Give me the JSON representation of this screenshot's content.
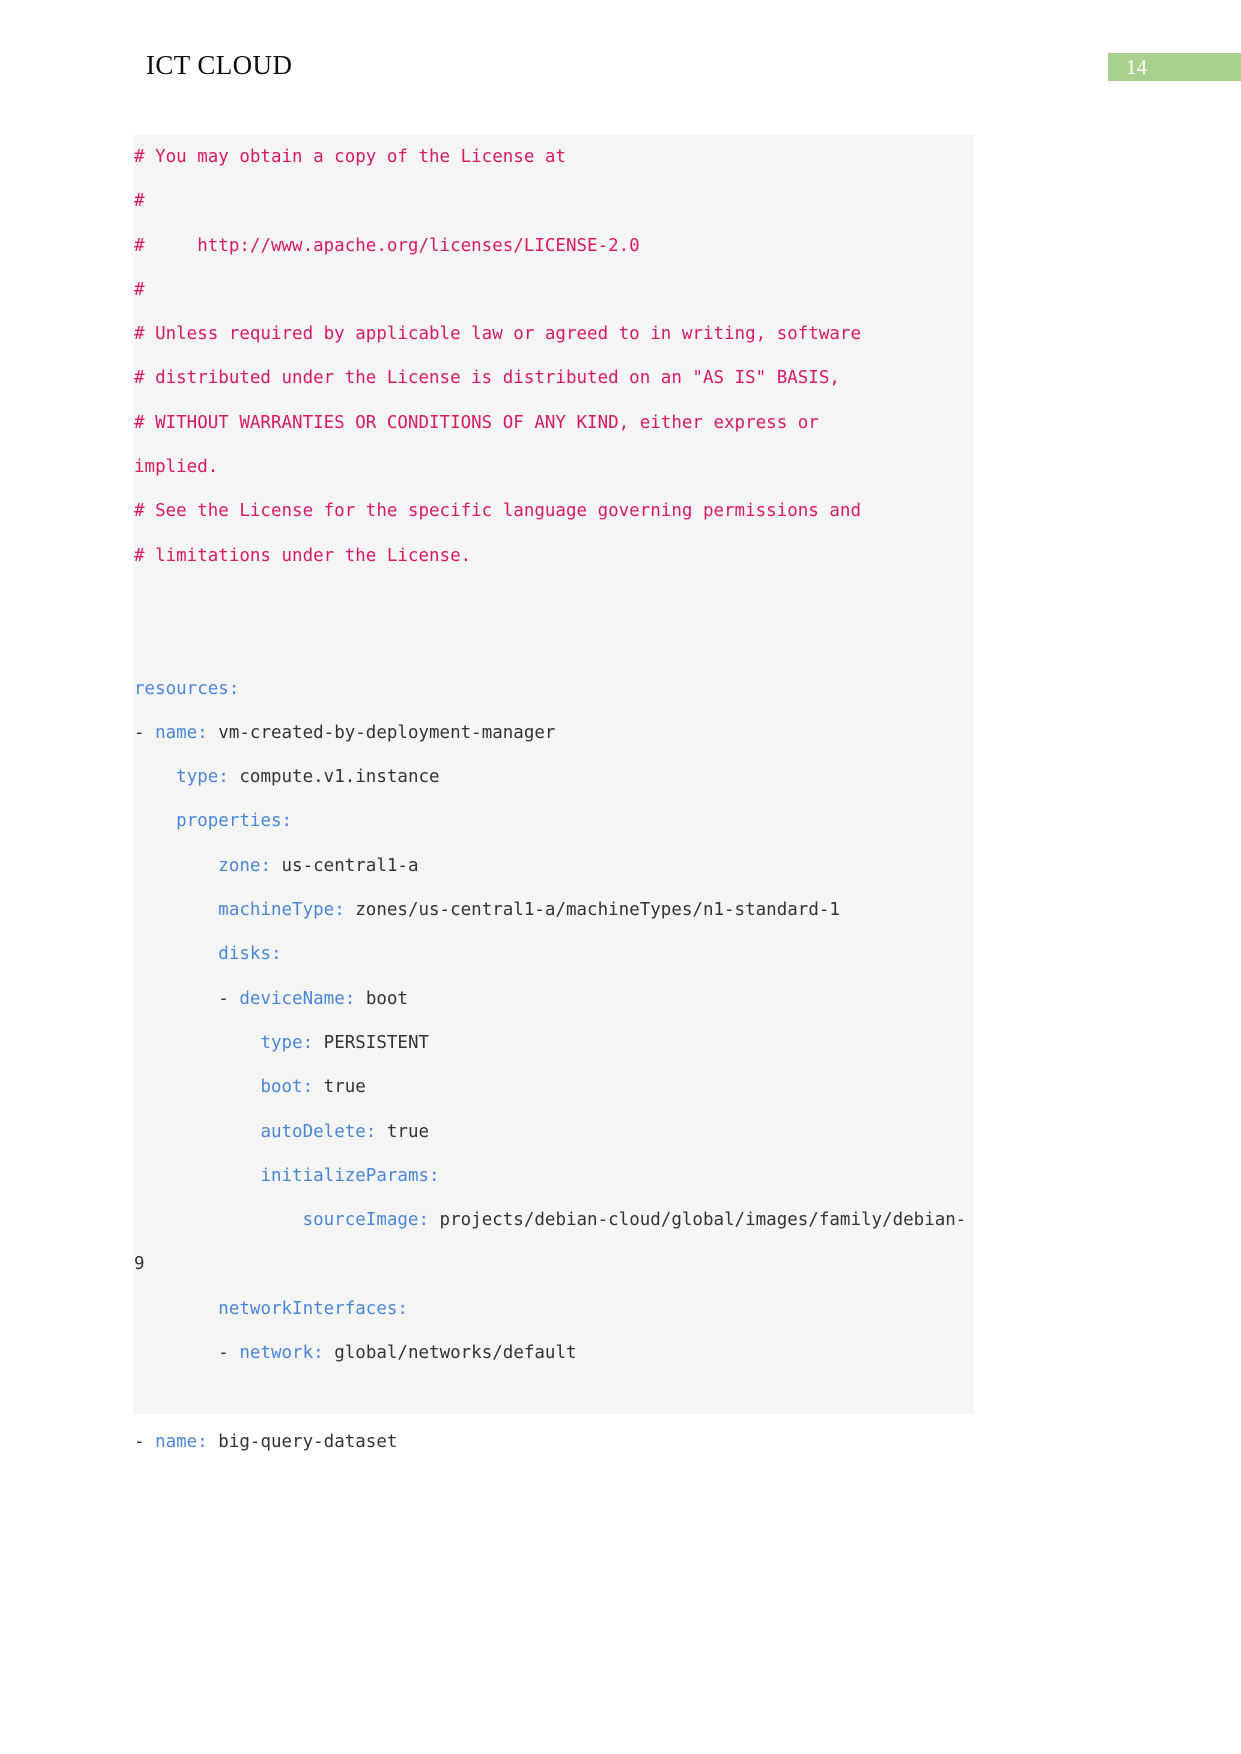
{
  "header": {
    "title": "ICT CLOUD",
    "page_number": "14",
    "badge_color": "#a9d18e",
    "badge_text_color": "#ffffff"
  },
  "code_block": {
    "background_color": "#f5f5f5",
    "comment_color": "#d81b60",
    "key_color": "#4a86d8",
    "value_color": "#333333",
    "language": "yaml",
    "lines": [
      {
        "indent": 0,
        "type": "comment",
        "text": "# You may obtain a copy of the License at"
      },
      {
        "indent": 0,
        "type": "comment",
        "text": "#"
      },
      {
        "indent": 0,
        "type": "comment",
        "text": "#     http://www.apache.org/licenses/LICENSE-2.0"
      },
      {
        "indent": 0,
        "type": "comment",
        "text": "#"
      },
      {
        "indent": 0,
        "type": "comment",
        "text": "# Unless required by applicable law or agreed to in writing, software"
      },
      {
        "indent": 0,
        "type": "comment",
        "text": "# distributed under the License is distributed on an \"AS IS\" BASIS,"
      },
      {
        "indent": 0,
        "type": "comment",
        "text": "# WITHOUT WARRANTIES OR CONDITIONS OF ANY KIND, either express or"
      },
      {
        "indent": 0,
        "type": "comment",
        "text": "implied.",
        "continuation": true
      },
      {
        "indent": 0,
        "type": "comment",
        "text": "# See the License for the specific language governing permissions and"
      },
      {
        "indent": 0,
        "type": "comment",
        "text": "# limitations under the License."
      },
      {
        "indent": 0,
        "type": "blank",
        "text": ""
      },
      {
        "indent": 0,
        "type": "blank",
        "text": ""
      },
      {
        "indent": 0,
        "type": "key",
        "key": "resources:",
        "value": ""
      },
      {
        "indent": 0,
        "type": "listkey",
        "dash": "- ",
        "key": "name:",
        "value": " vm-created-by-deployment-manager"
      },
      {
        "indent": 2,
        "type": "key",
        "key": "type:",
        "value": " compute.v1.instance"
      },
      {
        "indent": 2,
        "type": "key",
        "key": "properties:",
        "value": ""
      },
      {
        "indent": 4,
        "type": "key",
        "key": "zone:",
        "value": " us-central1-a"
      },
      {
        "indent": 4,
        "type": "key",
        "key": "machineType:",
        "value": " zones/us-central1-a/machineTypes/n1-standard-1"
      },
      {
        "indent": 4,
        "type": "key",
        "key": "disks:",
        "value": ""
      },
      {
        "indent": 4,
        "type": "listkey",
        "dash": "- ",
        "key": "deviceName:",
        "value": " boot"
      },
      {
        "indent": 6,
        "type": "key",
        "key": "type:",
        "value": " PERSISTENT"
      },
      {
        "indent": 6,
        "type": "key",
        "key": "boot:",
        "value": " true"
      },
      {
        "indent": 6,
        "type": "key",
        "key": "autoDelete:",
        "value": " true"
      },
      {
        "indent": 6,
        "type": "key",
        "key": "initializeParams:",
        "value": ""
      },
      {
        "indent": 8,
        "type": "key",
        "key": "sourceImage:",
        "value": " projects/debian-cloud/global/images/family/debian-"
      },
      {
        "indent": 0,
        "type": "value",
        "text": "9",
        "continuation": true
      },
      {
        "indent": 4,
        "type": "key",
        "key": "networkInterfaces:",
        "value": ""
      },
      {
        "indent": 4,
        "type": "listkey",
        "dash": "- ",
        "key": "network:",
        "value": " global/networks/default"
      },
      {
        "indent": 0,
        "type": "blank",
        "text": ""
      },
      {
        "indent": 0,
        "type": "listkey",
        "dash": "- ",
        "key": "name:",
        "value": " big-query-dataset"
      }
    ]
  }
}
